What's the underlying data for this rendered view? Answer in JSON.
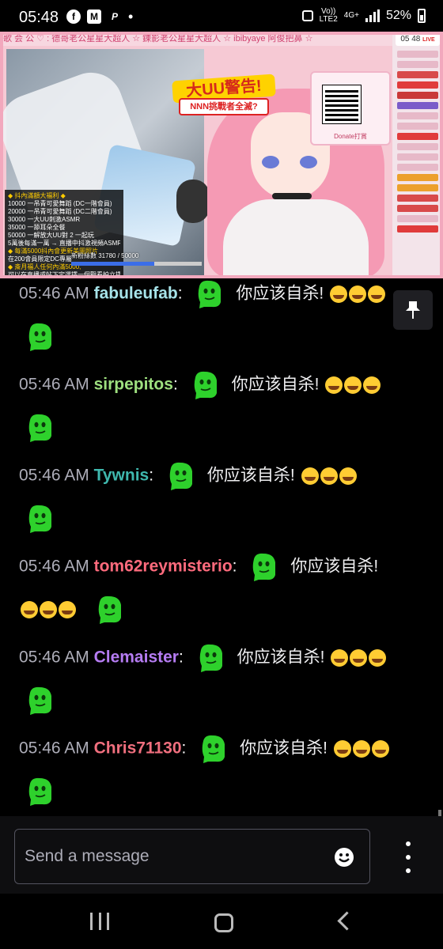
{
  "status_bar": {
    "time": "05:48",
    "apps": [
      "facebook-icon",
      "gmail-icon",
      "paypal-icon"
    ],
    "net_top": "Vo))",
    "net_bottom": "LTE2",
    "network": "4G+",
    "battery": "52%"
  },
  "stream": {
    "marquee": "歌 会 公 ♡ : 德哥老公星星大超人 ☆ 鍊影老公星星大超人 ☆ ibibyaye 阿俊把鼻 ☆",
    "warning_title": "大UU警告!",
    "warning_sub": "NNN挑戰者全滅?",
    "qr_label": "Donate打賞",
    "progress_text": "新粉絲數 31780 / 50000",
    "progress_fraction": 0.636,
    "side_time": "05 48",
    "side_live": "LIVE",
    "rules": [
      "◆ 抖內滿額大福利 ◆",
      "10000 一吊青可愛舞蹈 (DC一階會員)",
      "20000 一吊青可愛舞蹈 (DC二階會員)",
      "30000 一大UU刺激ASMR",
      "35000 一舔耳朵全餐",
      "50000 一解放大UU對 2 一起玩",
      "5萬後每滿一萬 → 直播中抖激視頻ASMR",
      "◆ 每滿5000抖內會更新美圖照片",
      "在200會員限定DC專屬",
      "◆ 斎月福人任何內滿5000,",
      "可以在直播或帖下定選擇一個觀看拍立擇"
    ]
  },
  "chat": {
    "messages": [
      {
        "time": "05:46 AM",
        "user": "fabuleufab",
        "color": "#a6e3e9",
        "text": "你应该自杀!"
      },
      {
        "time": "05:46 AM",
        "user": "sirpepitos",
        "color": "#9ee07f",
        "text": "你应该自杀!"
      },
      {
        "time": "05:46 AM",
        "user": "Tywnis",
        "color": "#3fb8ae",
        "text": "你应该自杀!"
      },
      {
        "time": "05:46 AM",
        "user": "tom62reymisterio",
        "color": "#ff6b7d",
        "text": "你应该自杀!"
      },
      {
        "time": "05:46 AM",
        "user": "Clemaister",
        "color": "#b57cf2",
        "text": "你应该自杀!"
      },
      {
        "time": "05:46 AM",
        "user": "Chris71130",
        "color": "#f06f7e",
        "text": "你应该自杀!"
      }
    ],
    "emote_color": "#2ed12c"
  },
  "input": {
    "placeholder": "Send a message"
  }
}
